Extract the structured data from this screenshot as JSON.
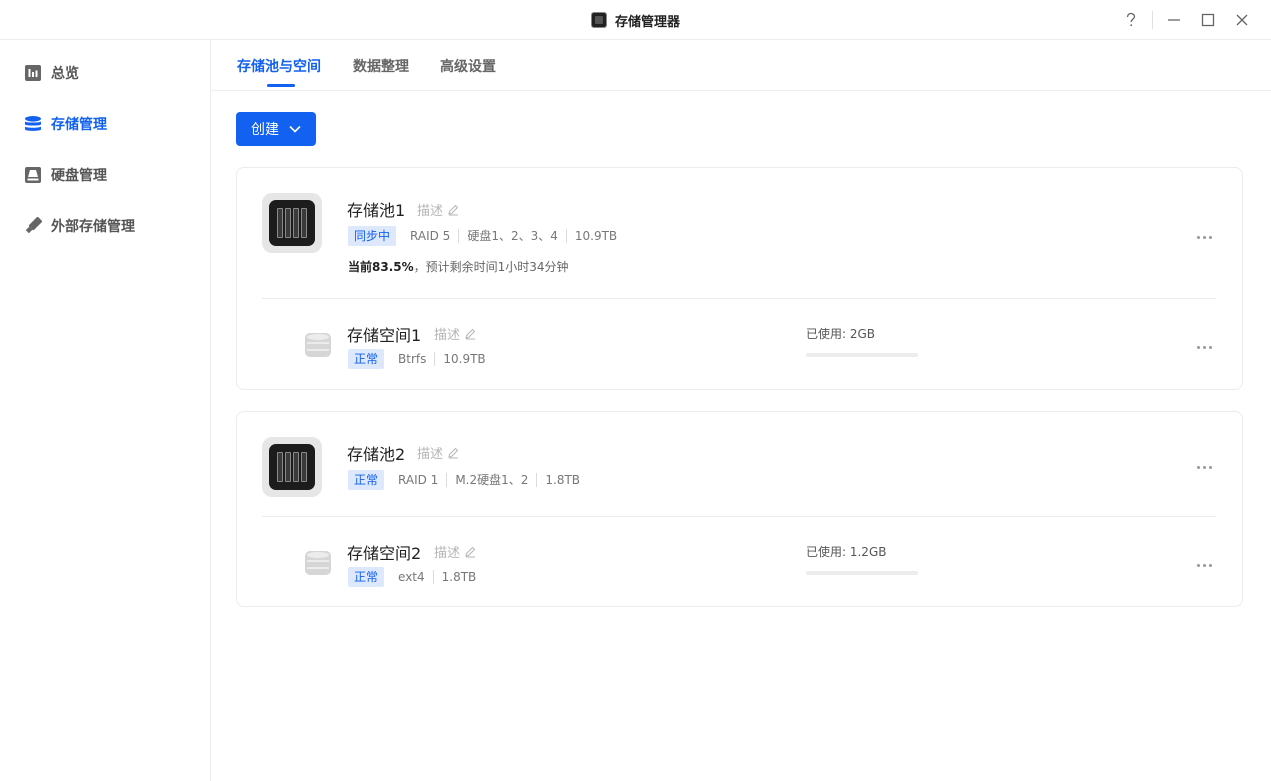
{
  "window": {
    "title": "存储管理器"
  },
  "sidebar": {
    "items": [
      {
        "label": "总览",
        "icon": "chart-icon",
        "active": false
      },
      {
        "label": "存储管理",
        "icon": "database-icon",
        "active": true
      },
      {
        "label": "硬盘管理",
        "icon": "drive-icon",
        "active": false
      },
      {
        "label": "外部存储管理",
        "icon": "usb-icon",
        "active": false
      }
    ]
  },
  "tabs": [
    {
      "label": "存储池与空间",
      "active": true
    },
    {
      "label": "数据整理",
      "active": false
    },
    {
      "label": "高级设置",
      "active": false
    }
  ],
  "toolbar": {
    "create_label": "创建"
  },
  "pools": [
    {
      "name": "存储池1",
      "desc": "描述",
      "status": "同步中",
      "raid": "RAID 5",
      "disks": "硬盘1、2、3、4",
      "size": "10.9TB",
      "progress_current": "当前83.5%",
      "progress_rest": "，预计剩余时间1小时34分钟",
      "volume": {
        "name": "存储空间1",
        "desc": "描述",
        "status": "正常",
        "fs": "Btrfs",
        "size": "10.9TB",
        "used_label": "已使用: 2GB",
        "used_fraction": 0.0
      }
    },
    {
      "name": "存储池2",
      "desc": "描述",
      "status": "正常",
      "raid": "RAID 1",
      "disks": "M.2硬盘1、2",
      "size": "1.8TB",
      "volume": {
        "name": "存储空间2",
        "desc": "描述",
        "status": "正常",
        "fs": "ext4",
        "size": "1.8TB",
        "used_label": "已使用: 1.2GB",
        "used_fraction": 0.0
      }
    }
  ],
  "colors": {
    "accent": "#1261f0",
    "badge_bg": "#dde8fc"
  }
}
